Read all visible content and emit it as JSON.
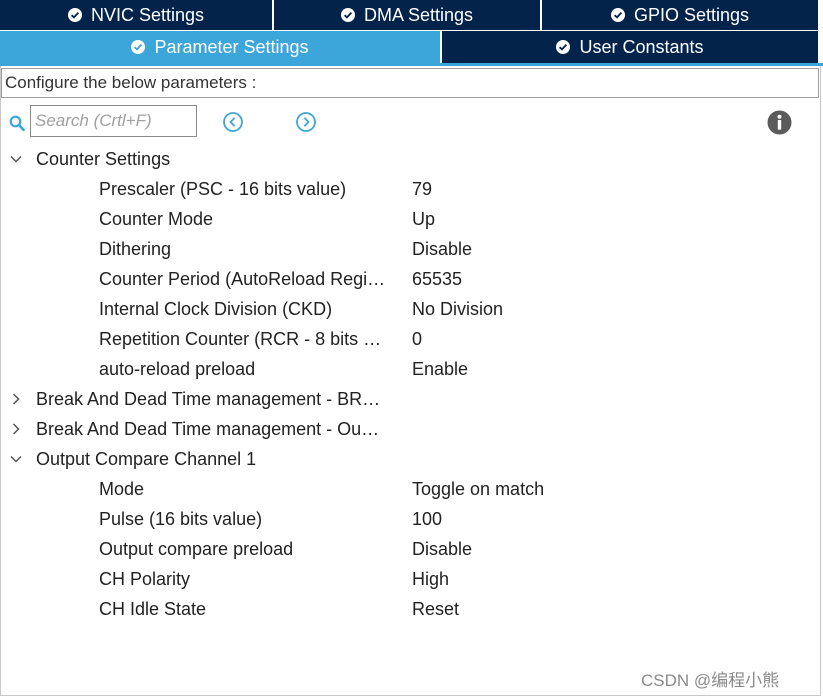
{
  "tabs": {
    "nvic": "NVIC Settings",
    "dma": "DMA Settings",
    "gpio": "GPIO Settings",
    "parameter": "Parameter Settings",
    "user_constants": "User Constants"
  },
  "colors": {
    "tab_dark": "#03234b",
    "tab_active": "#3ca5d9",
    "nav_icon": "#3ca5d9"
  },
  "configure_label": "Configure the below parameters :",
  "search": {
    "placeholder": "Search (Crtl+F)"
  },
  "icons": {
    "search": "search-icon",
    "prev": "chevron-left-circle-icon",
    "next": "chevron-right-circle-icon",
    "info": "info-icon"
  },
  "groups": {
    "counter": {
      "label": "Counter Settings",
      "expanded": true,
      "params": [
        {
          "name": "Prescaler (PSC - 16 bits value)",
          "value": "79"
        },
        {
          "name": "Counter Mode",
          "value": "Up"
        },
        {
          "name": "Dithering",
          "value": "Disable"
        },
        {
          "name": "Counter Period (AutoReload Regi…",
          "value": "65535"
        },
        {
          "name": "Internal Clock Division (CKD)",
          "value": "No Division"
        },
        {
          "name": "Repetition Counter (RCR - 8 bits …",
          "value": "0"
        },
        {
          "name": "auto-reload preload",
          "value": "Enable"
        }
      ]
    },
    "break1": {
      "label": "Break And Dead Time management - BR…",
      "expanded": false
    },
    "break2": {
      "label": "Break And Dead Time management - Ou…",
      "expanded": false
    },
    "occ1": {
      "label": "Output Compare Channel 1",
      "expanded": true,
      "params": [
        {
          "name": "Mode",
          "value": "Toggle on match"
        },
        {
          "name": "Pulse (16 bits value)",
          "value": "100"
        },
        {
          "name": "Output compare preload",
          "value": "Disable"
        },
        {
          "name": "CH Polarity",
          "value": "High"
        },
        {
          "name": "CH Idle State",
          "value": "Reset"
        }
      ]
    }
  },
  "watermark": "CSDN @编程小熊"
}
